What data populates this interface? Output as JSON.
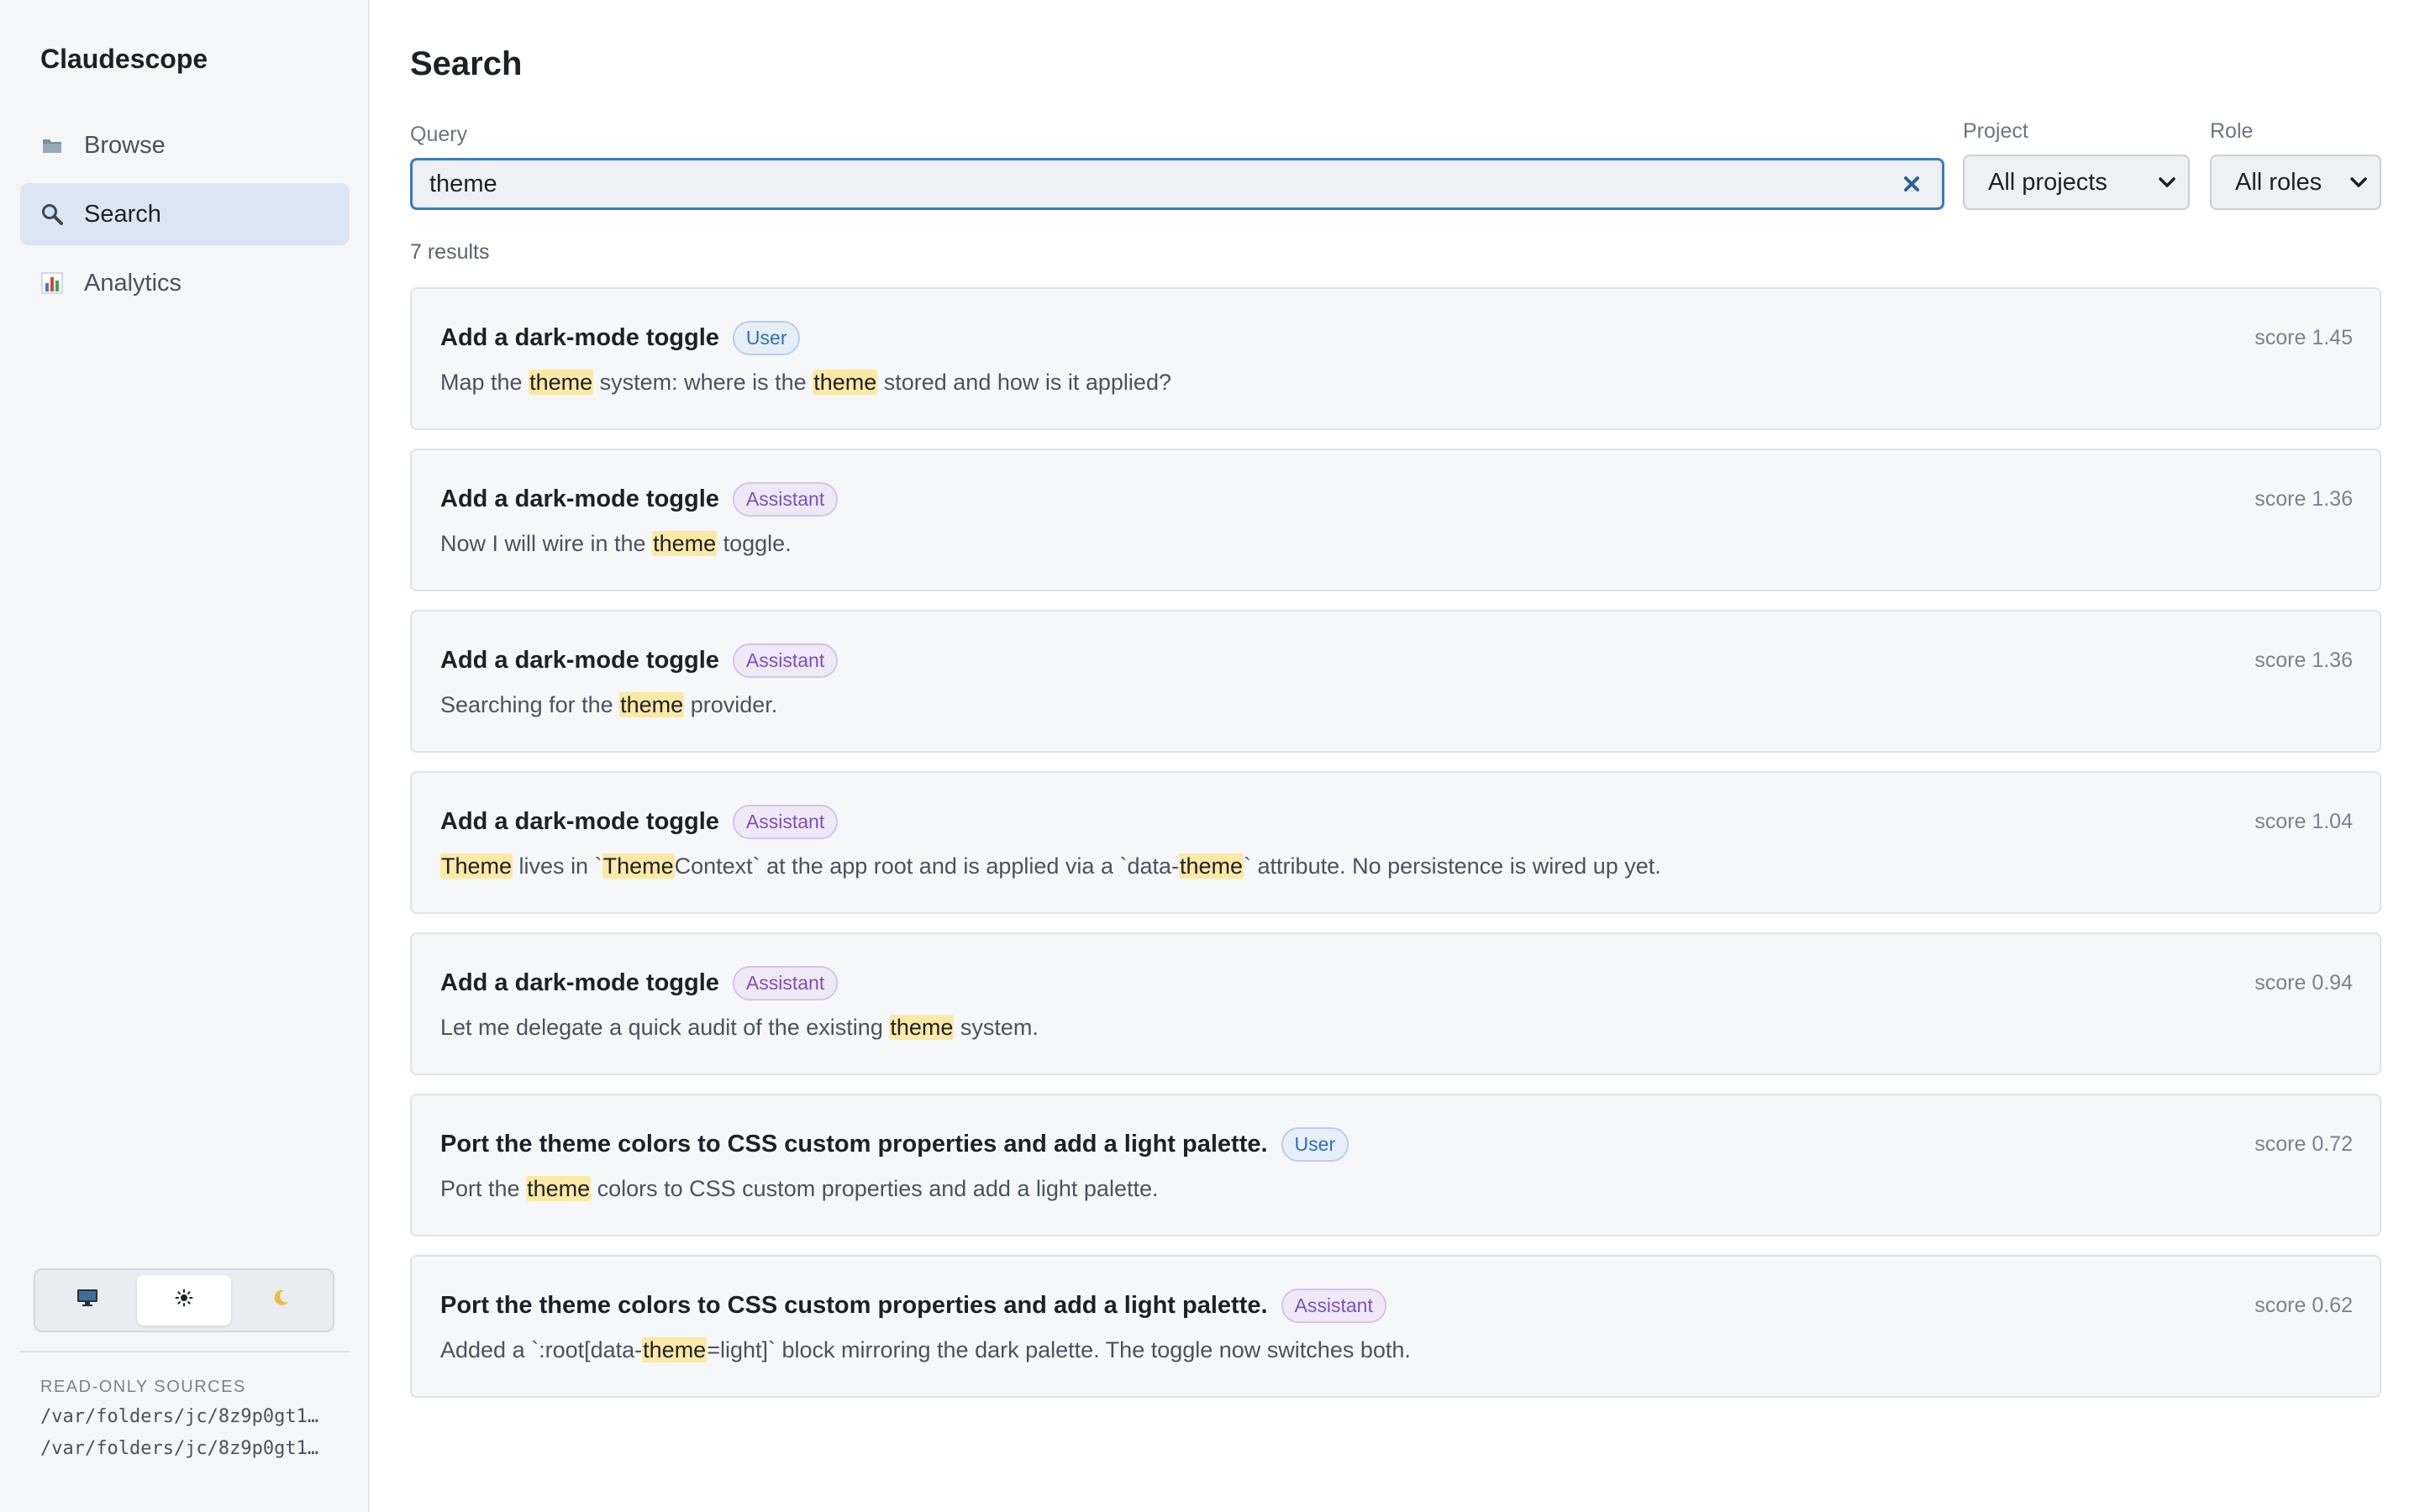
{
  "app": {
    "name": "Claudescope"
  },
  "nav": {
    "items": [
      {
        "label": "Browse",
        "icon": "folder-icon"
      },
      {
        "label": "Search",
        "icon": "search-icon",
        "active": true
      },
      {
        "label": "Analytics",
        "icon": "bar-chart-icon"
      }
    ]
  },
  "theme": {
    "options": [
      "monitor-icon",
      "sun-icon",
      "moon-icon"
    ],
    "selected": "sun-icon"
  },
  "sources": {
    "label": "READ-ONLY SOURCES",
    "paths": [
      "/var/folders/jc/8z9p0gt1…",
      "/var/folders/jc/8z9p0gt1…"
    ]
  },
  "page": {
    "title": "Search"
  },
  "query": {
    "label": "Query",
    "value": "theme"
  },
  "project": {
    "label": "Project",
    "value": "All projects"
  },
  "role": {
    "label": "Role",
    "value": "All roles"
  },
  "results_count": "7 results",
  "colors": {
    "accent": "#3b78c4",
    "highlight": "#fbe9a5",
    "user_badge": "#2f6fba",
    "assistant_badge": "#7a52b8"
  },
  "results": [
    {
      "title": "Add a dark-mode toggle",
      "role": "User",
      "score": "score 1.45",
      "snippet": [
        {
          "t": "Map the "
        },
        {
          "t": "theme",
          "h": true
        },
        {
          "t": " system: where is the "
        },
        {
          "t": "theme",
          "h": true
        },
        {
          "t": " stored and how is it applied?"
        }
      ]
    },
    {
      "title": "Add a dark-mode toggle",
      "role": "Assistant",
      "score": "score 1.36",
      "snippet": [
        {
          "t": "Now I will wire in the "
        },
        {
          "t": "theme",
          "h": true
        },
        {
          "t": " toggle."
        }
      ]
    },
    {
      "title": "Add a dark-mode toggle",
      "role": "Assistant",
      "score": "score 1.36",
      "snippet": [
        {
          "t": "Searching for the "
        },
        {
          "t": "theme",
          "h": true
        },
        {
          "t": " provider."
        }
      ]
    },
    {
      "title": "Add a dark-mode toggle",
      "role": "Assistant",
      "score": "score 1.04",
      "snippet": [
        {
          "t": "Theme",
          "h": true
        },
        {
          "t": " lives in `"
        },
        {
          "t": "Theme",
          "h": true
        },
        {
          "t": "Context` at the app root and is applied via a `data-"
        },
        {
          "t": "theme",
          "h": true
        },
        {
          "t": "` attribute. No persistence is wired up yet."
        }
      ]
    },
    {
      "title": "Add a dark-mode toggle",
      "role": "Assistant",
      "score": "score 0.94",
      "snippet": [
        {
          "t": "Let me delegate a quick audit of the existing "
        },
        {
          "t": "theme",
          "h": true
        },
        {
          "t": " system."
        }
      ]
    },
    {
      "title": "Port the theme colors to CSS custom properties and add a light palette.",
      "role": "User",
      "score": "score 0.72",
      "snippet": [
        {
          "t": "Port the "
        },
        {
          "t": "theme",
          "h": true
        },
        {
          "t": " colors to CSS custom properties and add a light palette."
        }
      ]
    },
    {
      "title": "Port the theme colors to CSS custom properties and add a light palette.",
      "role": "Assistant",
      "score": "score 0.62",
      "snippet": [
        {
          "t": "Added a `:root[data-"
        },
        {
          "t": "theme",
          "h": true
        },
        {
          "t": "=light]` block mirroring the dark palette. The toggle now switches both."
        }
      ]
    }
  ]
}
